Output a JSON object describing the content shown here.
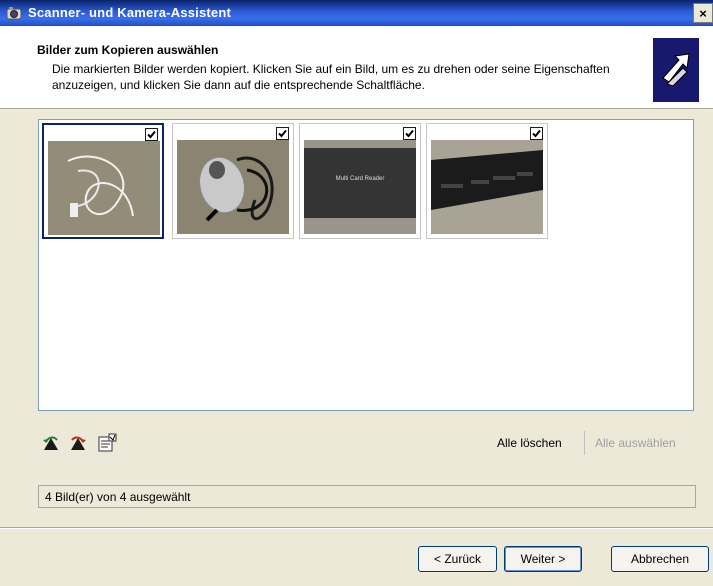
{
  "window": {
    "title": "Scanner- und Kamera-Assistent",
    "close_glyph": "×"
  },
  "header": {
    "title": "Bilder zum Kopieren auswählen",
    "description": "Die markierten Bilder werden kopiert. Klicken Sie auf ein Bild, um es zu drehen oder seine Eigenschaften anzuzeigen, und klicken Sie dann auf die entsprechende Schaltfläche.",
    "icon": "wizard-arrow-icon"
  },
  "images": [
    {
      "subject": "white-usb-cable",
      "checked": true,
      "selected": true
    },
    {
      "subject": "computer-mouse",
      "checked": true,
      "selected": false
    },
    {
      "subject": "card-reader",
      "checked": true,
      "selected": false,
      "printed_label": "Multi Card Reader"
    },
    {
      "subject": "card-reader-slots",
      "checked": true,
      "selected": false
    }
  ],
  "toolbar": {
    "rotate_left_icon": "rotate-left-icon",
    "rotate_right_icon": "rotate-right-icon",
    "properties_icon": "properties-icon",
    "clear_all": "Alle löschen",
    "select_all": "Alle auswählen"
  },
  "status": {
    "text": "4 Bild(er) von 4 ausgewählt"
  },
  "buttons": {
    "back": "< Zurück",
    "next": "Weiter >",
    "cancel": "Abbrechen"
  },
  "colors": {
    "titlebar": "#0a246a",
    "selection": "#0a246a",
    "window_bg": "#ece9d8",
    "header_bg": "#ffffff"
  }
}
